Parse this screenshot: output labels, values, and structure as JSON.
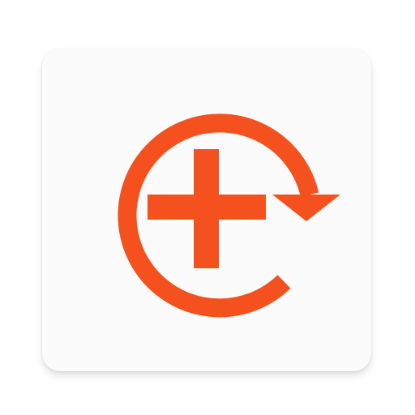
{
  "app_icon": {
    "icon": "circular-arrow-plus-icon",
    "tile_color": "#fbfbfb",
    "accent_color": "#f4511e"
  }
}
